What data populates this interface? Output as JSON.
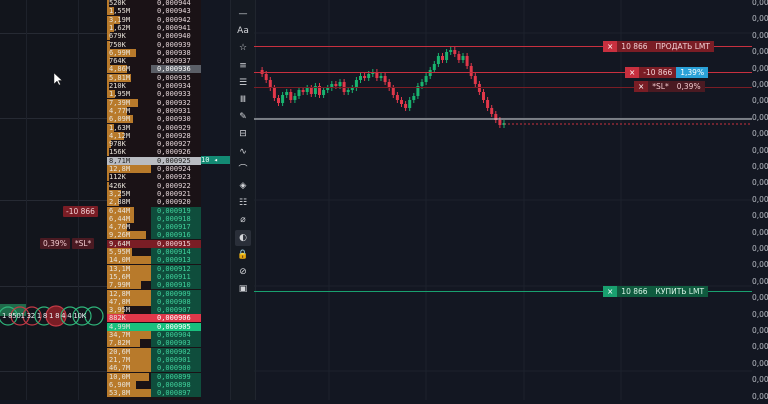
{
  "left_pane": {
    "position_tag": "-10 866",
    "pct_tag": "0,39%",
    "sl_tag": "*SL*",
    "cluster_text": "1 8501 32 1 8 1 8 4 4 10K"
  },
  "order_book": {
    "rows": [
      {
        "vol": "520K",
        "price": "0,000944",
        "side": "ask"
      },
      {
        "vol": "1,55M",
        "price": "0,000943",
        "side": "ask"
      },
      {
        "vol": "3,19M",
        "price": "0,000942",
        "side": "ask"
      },
      {
        "vol": "1,62M",
        "price": "0,000941",
        "side": "ask"
      },
      {
        "vol": "679K",
        "price": "0,000940",
        "side": "ask"
      },
      {
        "vol": "750K",
        "price": "0,000939",
        "side": "ask"
      },
      {
        "vol": "6,99M",
        "price": "0,000938",
        "side": "ask"
      },
      {
        "vol": "764K",
        "price": "0,000937",
        "side": "ask"
      },
      {
        "vol": "4,86M",
        "price": "0,000936",
        "side": "ask",
        "highlight": "grey"
      },
      {
        "vol": "5,81M",
        "price": "0,000935",
        "side": "ask"
      },
      {
        "vol": "210K",
        "price": "0,000934",
        "side": "ask"
      },
      {
        "vol": "1,95M",
        "price": "0,000933",
        "side": "ask"
      },
      {
        "vol": "7,39M",
        "price": "0,000932",
        "side": "ask"
      },
      {
        "vol": "4,77M",
        "price": "0,000931",
        "side": "ask"
      },
      {
        "vol": "6,09M",
        "price": "0,000930",
        "side": "ask"
      },
      {
        "vol": "1,63M",
        "price": "0,000929",
        "side": "ask"
      },
      {
        "vol": "4,12M",
        "price": "0,000928",
        "side": "ask"
      },
      {
        "vol": "978K",
        "price": "0,000927",
        "side": "ask"
      },
      {
        "vol": "156K",
        "price": "0,000926",
        "side": "ask"
      },
      {
        "vol": "8,71M",
        "price": "0,000925",
        "side": "ask",
        "highlight": "light"
      },
      {
        "vol": "12,8M",
        "price": "0,000924",
        "side": "ask"
      },
      {
        "vol": "112K",
        "price": "0,000923",
        "side": "ask"
      },
      {
        "vol": "426K",
        "price": "0,000922",
        "side": "ask"
      },
      {
        "vol": "3,25M",
        "price": "0,000921",
        "side": "ask"
      },
      {
        "vol": "2,88M",
        "price": "0,000920",
        "side": "ask"
      },
      {
        "vol": "6,44M",
        "price": "0,000919",
        "side": "bid"
      },
      {
        "vol": "6,44M",
        "price": "0,000918",
        "side": "bid"
      },
      {
        "vol": "4,76M",
        "price": "0,000917",
        "side": "bid"
      },
      {
        "vol": "9,26M",
        "price": "0,000916",
        "side": "bid"
      },
      {
        "vol": "9,64M",
        "price": "0,000915",
        "side": "bid",
        "highlight": "red"
      },
      {
        "vol": "5,95M",
        "price": "0,000914",
        "side": "bid"
      },
      {
        "vol": "14,0M",
        "price": "0,000913",
        "side": "bid"
      },
      {
        "vol": "13,1M",
        "price": "0,000912",
        "side": "bid"
      },
      {
        "vol": "15,6M",
        "price": "0,000911",
        "side": "bid"
      },
      {
        "vol": "7,99M",
        "price": "0,000910",
        "side": "bid"
      },
      {
        "vol": "12,8M",
        "price": "0,000909",
        "side": "bid"
      },
      {
        "vol": "47,8M",
        "price": "0,000908",
        "side": "bid"
      },
      {
        "vol": "3,95M",
        "price": "0,000907",
        "side": "bid"
      },
      {
        "vol": "882K",
        "price": "0,000906",
        "side": "bid",
        "highlight": "red-strong"
      },
      {
        "vol": "4,99M",
        "price": "0,000905",
        "side": "bid",
        "highlight": "green-strong"
      },
      {
        "vol": "34,7M",
        "price": "0,000904",
        "side": "bid"
      },
      {
        "vol": "7,82M",
        "price": "0,000903",
        "side": "bid"
      },
      {
        "vol": "20,6M",
        "price": "0,000902",
        "side": "bid"
      },
      {
        "vol": "21,7M",
        "price": "0,000901",
        "side": "bid"
      },
      {
        "vol": "46,7M",
        "price": "0,000900",
        "side": "bid"
      },
      {
        "vol": "10,0M",
        "price": "0,000899",
        "side": "bid"
      },
      {
        "vol": "6,90M",
        "price": "0,000898",
        "side": "bid"
      },
      {
        "vol": "53,8M",
        "price": "0,000897",
        "side": "bid"
      }
    ],
    "mid_tag": "10"
  },
  "toolbar": {
    "items": [
      {
        "name": "crosshair-tool-icon",
        "glyph": "—"
      },
      {
        "name": "text-tool-icon",
        "glyph": "Aa"
      },
      {
        "name": "favorite-star-icon",
        "glyph": "☆"
      },
      {
        "name": "lines-tool-icon",
        "glyph": "≡"
      },
      {
        "name": "fib-tool-icon",
        "glyph": "☰"
      },
      {
        "name": "volume-profile-icon",
        "glyph": "Ⅲ"
      },
      {
        "name": "brush-tool-icon",
        "glyph": "✎"
      },
      {
        "name": "measure-tool-icon",
        "glyph": "⊟"
      },
      {
        "name": "trend-tool-icon",
        "glyph": "∿"
      },
      {
        "name": "arc-tool-icon",
        "glyph": "⌒"
      },
      {
        "name": "ruler-tool-icon",
        "glyph": "◈"
      },
      {
        "name": "notes-tool-icon",
        "glyph": "☷"
      },
      {
        "name": "eraser-icon",
        "glyph": "⌀"
      },
      {
        "name": "magnet-icon",
        "glyph": "◐"
      },
      {
        "name": "lock-icon",
        "glyph": "🔒"
      },
      {
        "name": "hide-drawings-icon",
        "glyph": "⊘"
      },
      {
        "name": "edit-square-icon",
        "glyph": "▣"
      }
    ]
  },
  "orders": {
    "sell": {
      "x": "×",
      "qty": "10 866",
      "label": "ПРОДАТЬ LMT"
    },
    "position": {
      "x": "×",
      "qty": "-10 866",
      "pct": "1,39%"
    },
    "stop": {
      "x": "×",
      "label": "*SL*",
      "pct": "0,39%"
    },
    "buy": {
      "x": "×",
      "qty": "10 866",
      "label": "КУПИТЬ LMT"
    }
  },
  "price_axis": {
    "labels": [
      "0,00",
      "0,00",
      "0,00",
      "0,00",
      "0,00",
      "0,00",
      "0,00",
      "0,00",
      "0,00",
      "0,00",
      "0,00",
      "0,00",
      "0,00",
      "0,00",
      "0,00",
      "0,00",
      "0,00",
      "0,00",
      "0,00",
      "0,00",
      "0,00",
      "0,00",
      "0,00",
      "0,00",
      "0,00"
    ]
  },
  "colors": {
    "ask_bg": "#1a1216",
    "bid_bg": "#0f4d3c",
    "ask_price": "#e3d4d7",
    "bid_price": "#3fd19b",
    "volume_bar": "#b87a2b",
    "red": "#c8303f",
    "green": "#19a06f"
  }
}
